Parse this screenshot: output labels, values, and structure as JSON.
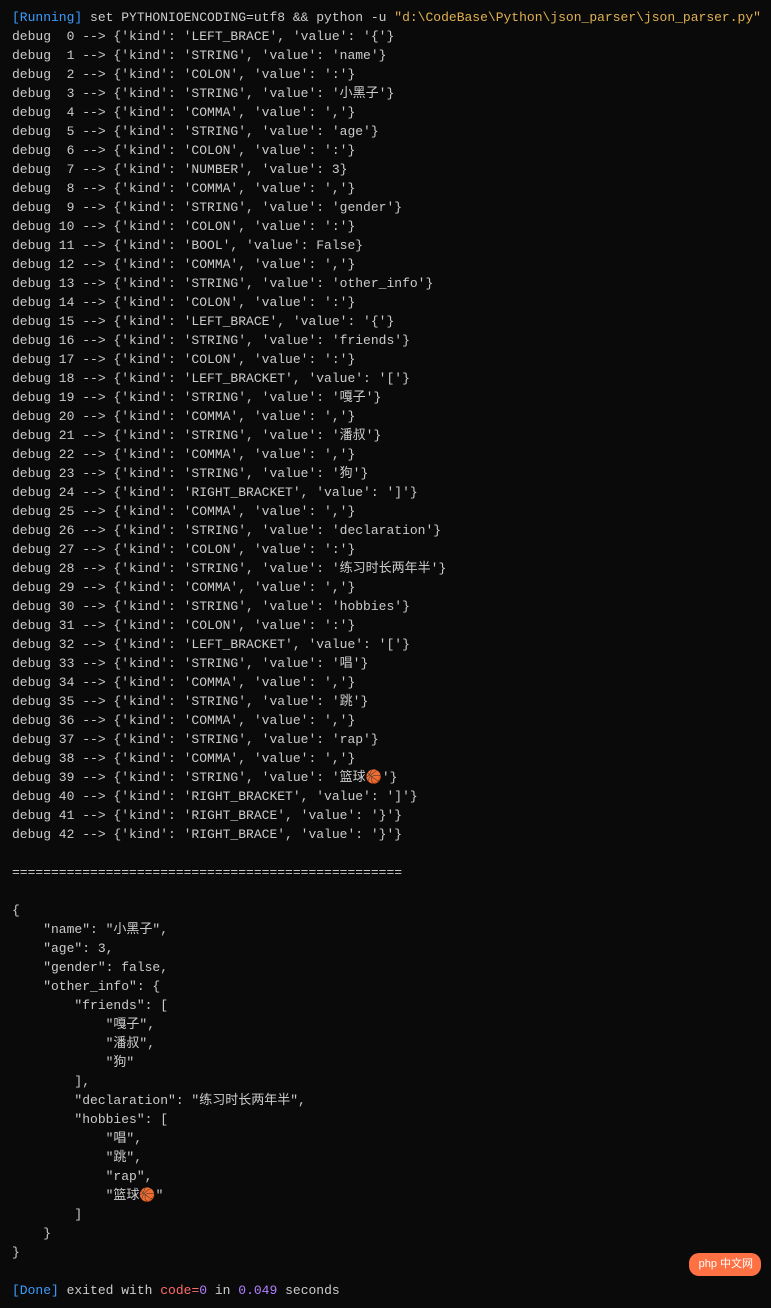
{
  "header": {
    "running_label": "[Running]",
    "command": " set PYTHONIOENCODING=utf8 && python -u ",
    "path": "\"d:\\CodeBase\\Python\\json_parser\\json_parser.py\""
  },
  "debug_lines": [
    "debug  0 --> {'kind': 'LEFT_BRACE', 'value': '{'}",
    "debug  1 --> {'kind': 'STRING', 'value': 'name'}",
    "debug  2 --> {'kind': 'COLON', 'value': ':'}",
    "debug  3 --> {'kind': 'STRING', 'value': '小黑子'}",
    "debug  4 --> {'kind': 'COMMA', 'value': ','}",
    "debug  5 --> {'kind': 'STRING', 'value': 'age'}",
    "debug  6 --> {'kind': 'COLON', 'value': ':'}",
    "debug  7 --> {'kind': 'NUMBER', 'value': 3}",
    "debug  8 --> {'kind': 'COMMA', 'value': ','}",
    "debug  9 --> {'kind': 'STRING', 'value': 'gender'}",
    "debug 10 --> {'kind': 'COLON', 'value': ':'}",
    "debug 11 --> {'kind': 'BOOL', 'value': False}",
    "debug 12 --> {'kind': 'COMMA', 'value': ','}",
    "debug 13 --> {'kind': 'STRING', 'value': 'other_info'}",
    "debug 14 --> {'kind': 'COLON', 'value': ':'}",
    "debug 15 --> {'kind': 'LEFT_BRACE', 'value': '{'}",
    "debug 16 --> {'kind': 'STRING', 'value': 'friends'}",
    "debug 17 --> {'kind': 'COLON', 'value': ':'}",
    "debug 18 --> {'kind': 'LEFT_BRACKET', 'value': '['}",
    "debug 19 --> {'kind': 'STRING', 'value': '嘎子'}",
    "debug 20 --> {'kind': 'COMMA', 'value': ','}",
    "debug 21 --> {'kind': 'STRING', 'value': '潘叔'}",
    "debug 22 --> {'kind': 'COMMA', 'value': ','}",
    "debug 23 --> {'kind': 'STRING', 'value': '狗'}",
    "debug 24 --> {'kind': 'RIGHT_BRACKET', 'value': ']'}",
    "debug 25 --> {'kind': 'COMMA', 'value': ','}",
    "debug 26 --> {'kind': 'STRING', 'value': 'declaration'}",
    "debug 27 --> {'kind': 'COLON', 'value': ':'}",
    "debug 28 --> {'kind': 'STRING', 'value': '练习时长两年半'}",
    "debug 29 --> {'kind': 'COMMA', 'value': ','}",
    "debug 30 --> {'kind': 'STRING', 'value': 'hobbies'}",
    "debug 31 --> {'kind': 'COLON', 'value': ':'}",
    "debug 32 --> {'kind': 'LEFT_BRACKET', 'value': '['}",
    "debug 33 --> {'kind': 'STRING', 'value': '唱'}",
    "debug 34 --> {'kind': 'COMMA', 'value': ','}",
    "debug 35 --> {'kind': 'STRING', 'value': '跳'}",
    "debug 36 --> {'kind': 'COMMA', 'value': ','}",
    "debug 37 --> {'kind': 'STRING', 'value': 'rap'}",
    "debug 38 --> {'kind': 'COMMA', 'value': ','}",
    "debug 39 --> {'kind': 'STRING', 'value': '篮球🏀'}",
    "debug 40 --> {'kind': 'RIGHT_BRACKET', 'value': ']'}",
    "debug 41 --> {'kind': 'RIGHT_BRACE', 'value': '}'}",
    "debug 42 --> {'kind': 'RIGHT_BRACE', 'value': '}'}"
  ],
  "separator": "==================================================",
  "json_output": [
    "{",
    "    \"name\": \"小黑子\",",
    "    \"age\": 3,",
    "    \"gender\": false,",
    "    \"other_info\": {",
    "        \"friends\": [",
    "            \"嘎子\",",
    "            \"潘叔\",",
    "            \"狗\"",
    "        ],",
    "        \"declaration\": \"练习时长两年半\",",
    "        \"hobbies\": [",
    "            \"唱\",",
    "            \"跳\",",
    "            \"rap\",",
    "            \"篮球🏀\"",
    "        ]",
    "    }",
    "}"
  ],
  "footer": {
    "done_label": "[Done]",
    "exited_text": " exited with ",
    "code_label": "code=",
    "code_value": "0",
    "in_text": " in ",
    "time_value": "0.049",
    "seconds_text": " seconds"
  },
  "badge": "php 中文网"
}
